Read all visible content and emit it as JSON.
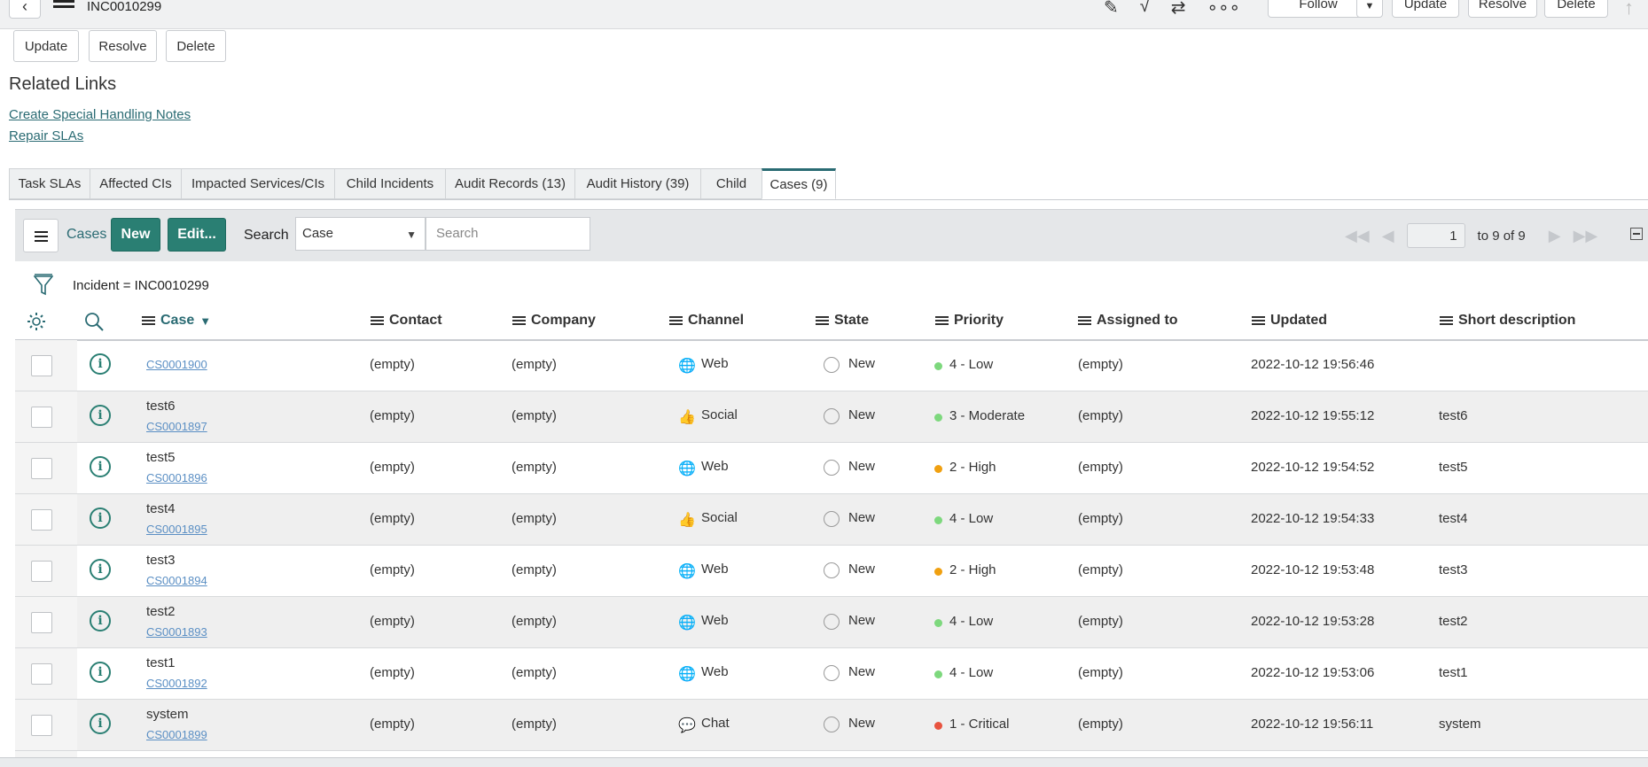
{
  "header": {
    "record_number": "INC0010299",
    "follow_label": "Follow",
    "update_label": "Update",
    "resolve_label": "Resolve",
    "delete_label": "Delete"
  },
  "actions": {
    "update_label": "Update",
    "resolve_label": "Resolve",
    "delete_label": "Delete"
  },
  "related_links": {
    "title": "Related Links",
    "items": [
      "Create Special Handling Notes",
      "Repair SLAs"
    ]
  },
  "tabs": [
    "Task SLAs",
    "Affected CIs",
    "Impacted Services/CIs",
    "Child Incidents",
    "Audit Records (13)",
    "Audit History (39)",
    "Child",
    "Cases (9)"
  ],
  "active_tab": "Cases (9)",
  "list": {
    "title": "Cases",
    "new_label": "New",
    "edit_label": "Edit...",
    "search_label": "Search",
    "search_field_value": "Case",
    "search_placeholder": "Search",
    "page_number": "1",
    "page_range": "to 9 of 9",
    "filter_text": "Incident = INC0010299"
  },
  "columns": [
    "Case",
    "Contact",
    "Company",
    "Channel",
    "State",
    "Priority",
    "Assigned to",
    "Updated",
    "Short description"
  ],
  "rows": [
    {
      "name": "",
      "number": "CS0001900",
      "contact": "(empty)",
      "company": "(empty)",
      "channel": "Web",
      "state": "New",
      "priority": "4 - Low",
      "priority_color": "#7dd87d",
      "assigned": "(empty)",
      "updated": "2022-10-12 19:56:46",
      "short_description": ""
    },
    {
      "name": "test6",
      "number": "CS0001897",
      "contact": "(empty)",
      "company": "(empty)",
      "channel": "Social",
      "state": "New",
      "priority": "3 - Moderate",
      "priority_color": "#7dd87d",
      "assigned": "(empty)",
      "updated": "2022-10-12 19:55:12",
      "short_description": "test6"
    },
    {
      "name": "test5",
      "number": "CS0001896",
      "contact": "(empty)",
      "company": "(empty)",
      "channel": "Web",
      "state": "New",
      "priority": "2 - High",
      "priority_color": "#f0a010",
      "assigned": "(empty)",
      "updated": "2022-10-12 19:54:52",
      "short_description": "test5"
    },
    {
      "name": "test4",
      "number": "CS0001895",
      "contact": "(empty)",
      "company": "(empty)",
      "channel": "Social",
      "state": "New",
      "priority": "4 - Low",
      "priority_color": "#7dd87d",
      "assigned": "(empty)",
      "updated": "2022-10-12 19:54:33",
      "short_description": "test4"
    },
    {
      "name": "test3",
      "number": "CS0001894",
      "contact": "(empty)",
      "company": "(empty)",
      "channel": "Web",
      "state": "New",
      "priority": "2 - High",
      "priority_color": "#f0a010",
      "assigned": "(empty)",
      "updated": "2022-10-12 19:53:48",
      "short_description": "test3"
    },
    {
      "name": "test2",
      "number": "CS0001893",
      "contact": "(empty)",
      "company": "(empty)",
      "channel": "Web",
      "state": "New",
      "priority": "4 - Low",
      "priority_color": "#7dd87d",
      "assigned": "(empty)",
      "updated": "2022-10-12 19:53:28",
      "short_description": "test2"
    },
    {
      "name": "test1",
      "number": "CS0001892",
      "contact": "(empty)",
      "company": "(empty)",
      "channel": "Web",
      "state": "New",
      "priority": "4 - Low",
      "priority_color": "#7dd87d",
      "assigned": "(empty)",
      "updated": "2022-10-12 19:53:06",
      "short_description": "test1"
    },
    {
      "name": "system",
      "number": "CS0001899",
      "contact": "(empty)",
      "company": "(empty)",
      "channel": "Chat",
      "state": "New",
      "priority": "1 - Critical",
      "priority_color": "#e8533f",
      "assigned": "(empty)",
      "updated": "2022-10-12 19:56:11",
      "short_description": "system"
    }
  ],
  "icons": {
    "web": "globe-icon",
    "social": "thumbs-up-icon",
    "chat": "chat-bubble-icon"
  },
  "colors": {
    "accent": "#2a6b73",
    "button": "#2a7f73",
    "link": "#5b8fc4"
  }
}
